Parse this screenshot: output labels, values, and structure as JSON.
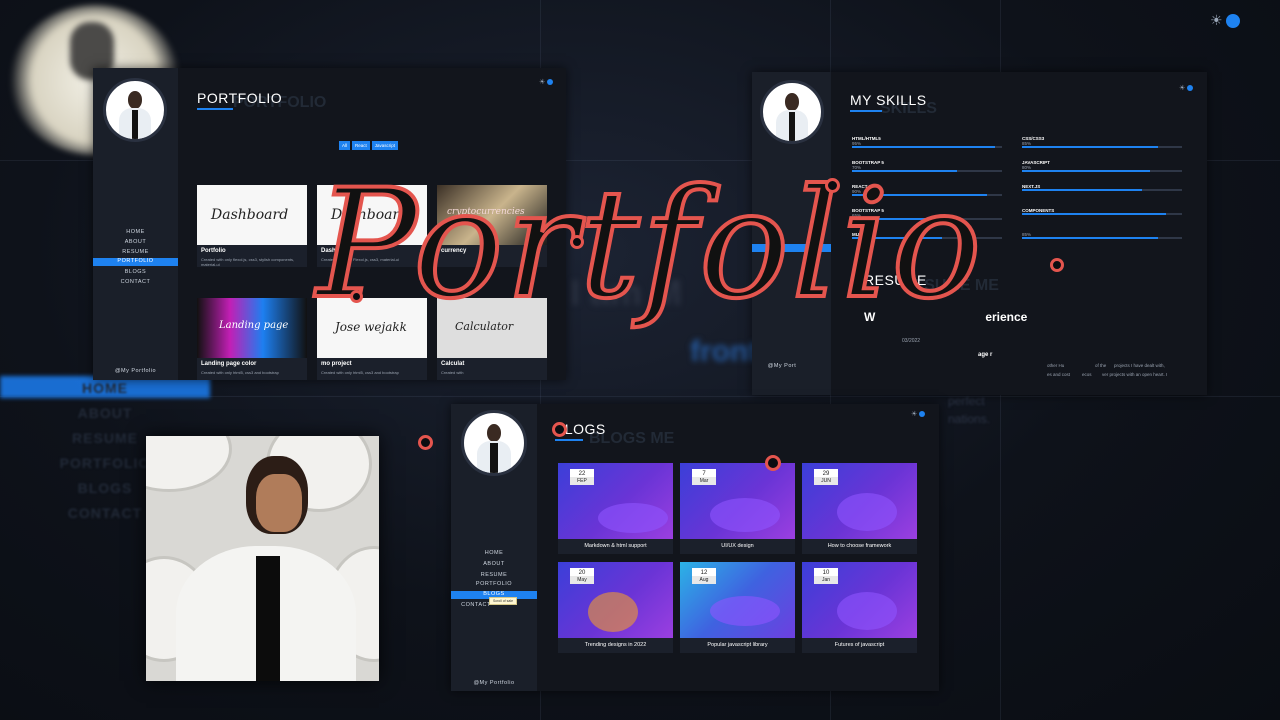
{
  "background": {
    "nav": [
      "HOME",
      "ABOUT",
      "RESUME",
      "PORTFOLIO",
      "BLOGS",
      "CONTACT"
    ],
    "hero_line1": "I am M",
    "hero_line2": "frontend",
    "about_text": "perfect\nnations."
  },
  "portfolio_panel": {
    "title": "PORTFOLIO",
    "ghost": "PORTFOLIO",
    "nav": [
      "HOME",
      "ABOUT",
      "RESUME",
      "PORTFOLIO",
      "BLOGS",
      "CONTACT"
    ],
    "active_nav": "PORTFOLIO",
    "footer": "@My Portfolio",
    "filters": [
      "All",
      "React",
      "Javascript"
    ],
    "cards": [
      {
        "thumb": "Dashboard",
        "title": "Portfolio",
        "desc": "Created with only flexol.js, css3, stylish components, material-ui"
      },
      {
        "thumb": "Dashboard",
        "title": "Dashboard",
        "desc": "Created with only Flexol.js, css3, material-ui"
      },
      {
        "thumb": "cryptocurrencies",
        "title": "currency",
        "desc": ""
      },
      {
        "thumb": "Landing page",
        "title": "Landing page color",
        "desc": "Created with only html5, css3 and bootstrap"
      },
      {
        "thumb": "Jose wejakk",
        "title": "mo project",
        "desc": "Created with only html5, css3 and bootstrap"
      },
      {
        "thumb": "Calculator",
        "title": "Calculat",
        "desc": "Created with"
      }
    ]
  },
  "skills_panel": {
    "title": "MY SKILLS",
    "ghost": "SKILLS",
    "resume_title": "RESUME",
    "resume_ghost": "RESUME ME",
    "experience_title": "W",
    "experience_suffix": "erience",
    "date": "03/2022",
    "job": "age r",
    "footer": "@My Port",
    "about_text": "other Hu",
    "about_text2": "of the",
    "about_text3": "projects I have dealt with,",
    "about_text4": "es and cost",
    "about_text5": "ecos",
    "about_text6": "ver projects with an open heart. I",
    "skills": [
      {
        "name": "HTML/HTML5",
        "pct": "95%",
        "value": 95
      },
      {
        "name": "CSS/CSS3",
        "pct": "85%",
        "value": 85
      },
      {
        "name": "BOOTSTRAP 5",
        "pct": "70%",
        "value": 70
      },
      {
        "name": "JAVASCRIPT",
        "pct": "80%",
        "value": 80
      },
      {
        "name": "REACT.JS",
        "pct": "90%",
        "value": 90
      },
      {
        "name": "NEXT.JS",
        "pct": "",
        "value": 75
      },
      {
        "name": "BOOTSTRAP 5",
        "pct": "65%",
        "value": 65
      },
      {
        "name": "COMPONENTS",
        "pct": "",
        "value": 90
      },
      {
        "name": "MU",
        "pct": "",
        "value": 60
      },
      {
        "name": "",
        "pct": "85%",
        "value": 85
      }
    ]
  },
  "blogs_panel": {
    "title": "BLOGS",
    "ghost": "BLOGS ME",
    "nav": [
      "HOME",
      "ABOUT",
      "RESUME",
      "PORTFOLIO",
      "BLOGS",
      "CONTACT"
    ],
    "active_nav": "BLOGS",
    "tooltip": "Scroll of sale",
    "footer": "@My Portfolio",
    "posts": [
      {
        "day": "22",
        "month": "FEP",
        "title": "Markdown & html support"
      },
      {
        "day": "7",
        "month": "Mar",
        "title": "UI/UX design"
      },
      {
        "day": "29",
        "month": "JUN",
        "title": "How to choose framework"
      },
      {
        "day": "20",
        "month": "May",
        "title": "Trending designs in 2022"
      },
      {
        "day": "12",
        "month": "Aug",
        "title": "Popular javascript library"
      },
      {
        "day": "10",
        "month": "Jan",
        "title": "Futures of javascript"
      }
    ]
  },
  "overlay": {
    "title": "Portfolio"
  },
  "colors": {
    "accent": "#1e82f0",
    "title_stroke": "#e4554e",
    "panel_bg": "#12151c"
  },
  "icons": [
    "sun-icon",
    "toggle-icon"
  ]
}
